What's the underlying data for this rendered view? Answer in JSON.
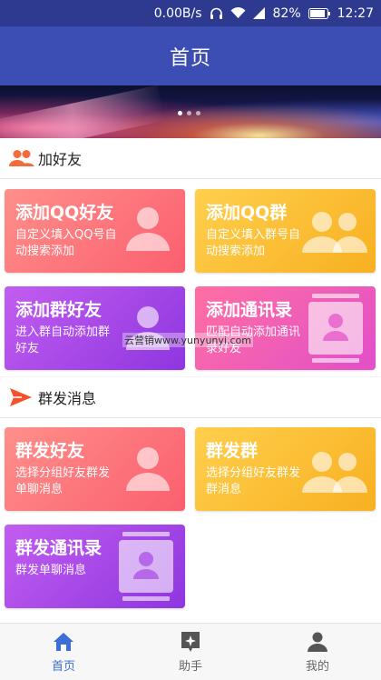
{
  "status_bar": {
    "speed": "0.00B/s",
    "battery": "82%",
    "time": "12:27"
  },
  "app_bar": {
    "title": "首页"
  },
  "banner": {
    "page_count": 3,
    "active_index": 0
  },
  "section_add": {
    "title": "加好友",
    "cards": [
      {
        "title": "添加QQ好友",
        "subtitle": "自定义填入QQ号自动搜索添加",
        "icon": "person-icon",
        "color": "#fb6f7a"
      },
      {
        "title": "添加QQ群",
        "subtitle": "自定义填入群号自动搜索添加",
        "icon": "group-icon",
        "color": "#fbbd35"
      },
      {
        "title": "添加群好友",
        "subtitle": "进入群自动添加群好友",
        "icon": "person-icon",
        "color": "#a847e6"
      },
      {
        "title": "添加通讯录",
        "subtitle": "匹配自动添加通讯录好友",
        "icon": "contact-card-icon",
        "color": "#f05ab8"
      }
    ]
  },
  "section_broadcast": {
    "title": "群发消息",
    "cards": [
      {
        "title": "群发好友",
        "subtitle": "选择分组好友群发单聊消息",
        "icon": "person-icon",
        "color": "#fb6f7a"
      },
      {
        "title": "群发群",
        "subtitle": "选择分组好友群发群消息",
        "icon": "group-icon",
        "color": "#fbbd35"
      },
      {
        "title": "群发通讯录",
        "subtitle": "群发单聊消息",
        "icon": "contact-card-icon",
        "color": "#a847e6"
      }
    ]
  },
  "watermark": "云营销www.yunyunyi.com",
  "bottom_nav": {
    "items": [
      {
        "label": "首页",
        "icon": "home-icon",
        "active": true
      },
      {
        "label": "助手",
        "icon": "assistant-icon",
        "active": false
      },
      {
        "label": "我的",
        "icon": "profile-icon",
        "active": false
      }
    ]
  }
}
